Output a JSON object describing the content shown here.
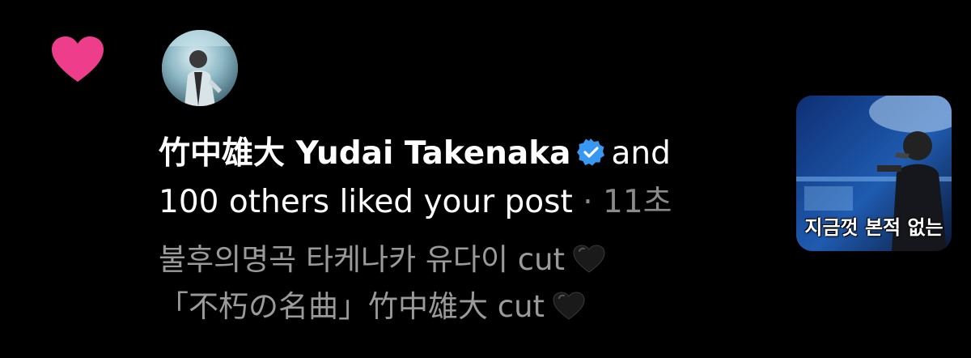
{
  "notification": {
    "username": "竹中雄大 Yudai Takenaka",
    "action_part1": "and",
    "action_part2": "100 others liked your post",
    "separator": "·",
    "timestamp": "11초",
    "snippet_line1": "불후의명곡 타케나카 유다이 cut",
    "snippet_line2": "「不朽の名曲」竹中雄大 cut",
    "thumbnail_caption": "지금껏 본적 없는"
  },
  "icons": {
    "like": "heart-icon",
    "verified": "verified-badge-icon",
    "emoji": "black-heart-icon"
  },
  "colors": {
    "heart": "#ee3d8a",
    "verified": "#3897f0",
    "meta_text": "#8a8a8a",
    "background": "#000000"
  }
}
